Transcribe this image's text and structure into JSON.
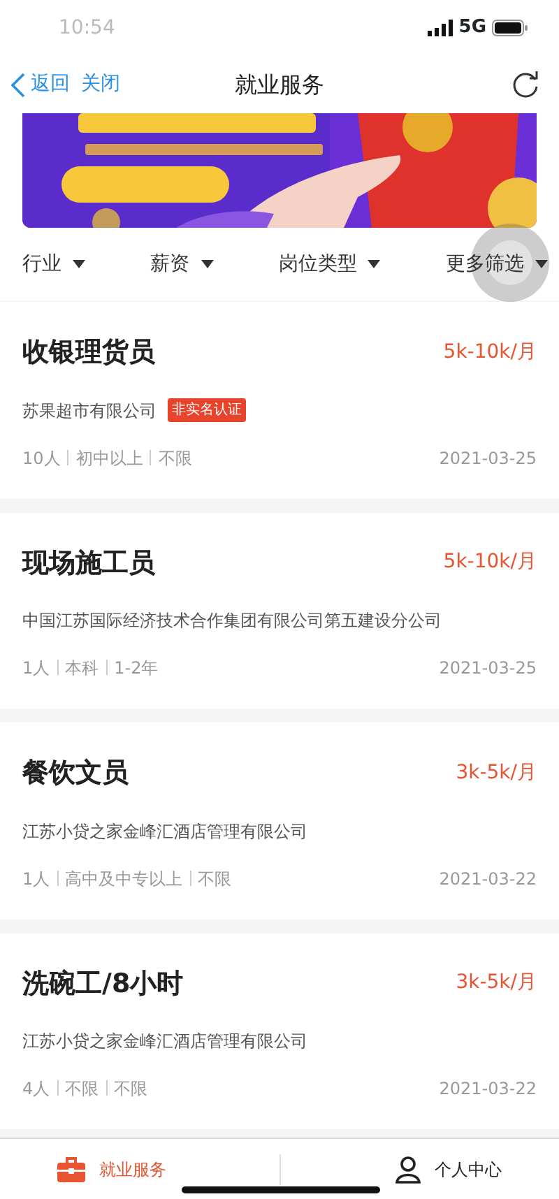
{
  "status_bar": {
    "time": "10:54",
    "network": "5G"
  },
  "nav": {
    "back": "返回",
    "close": "关闭",
    "title": "就业服务"
  },
  "filters": [
    {
      "label": "行业"
    },
    {
      "label": "薪资"
    },
    {
      "label": "岗位类型"
    },
    {
      "label": "更多筛选"
    }
  ],
  "jobs": [
    {
      "title": "收银理货员",
      "salary": "5k-10k/月",
      "company": "苏果超市有限公司",
      "tag": "非实名认证",
      "meta": [
        "10人",
        "初中以上",
        "不限"
      ],
      "date": "2021-03-25"
    },
    {
      "title": "现场施工员",
      "salary": "5k-10k/月",
      "company": "中国江苏国际经济技术合作集团有限公司第五建设分公司",
      "meta": [
        "1人",
        "本科",
        "1-2年"
      ],
      "date": "2021-03-25"
    },
    {
      "title": "餐饮文员",
      "salary": "3k-5k/月",
      "company": "江苏小贷之家金峰汇酒店管理有限公司",
      "meta": [
        "1人",
        "高中及中专以上",
        "不限"
      ],
      "date": "2021-03-22"
    },
    {
      "title": "洗碗工/8小时",
      "salary": "3k-5k/月",
      "company": "江苏小贷之家金峰汇酒店管理有限公司",
      "meta": [
        "4人",
        "不限",
        "不限"
      ],
      "date": "2021-03-22"
    }
  ],
  "tab_bar": [
    {
      "label": "就业服务",
      "kind": "briefcase",
      "selected": true
    },
    {
      "label": "个人中心",
      "kind": "person",
      "selected": false
    }
  ]
}
